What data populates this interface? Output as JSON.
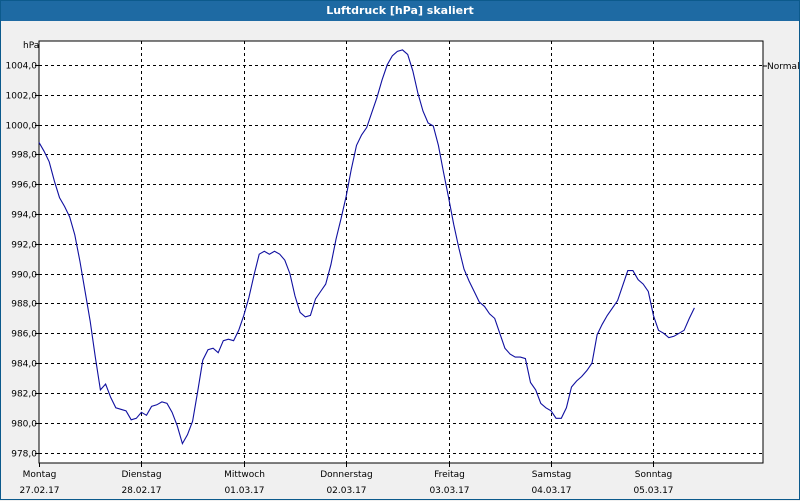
{
  "window": {
    "title": "Luftdruck [hPa] skaliert"
  },
  "chart_data": {
    "type": "line",
    "title": "Luftdruck [hPa] skaliert",
    "ylabel": "hPa",
    "xlabel": "",
    "ylim": [
      977.3,
      1005.6
    ],
    "y_ticks": [
      "978,0",
      "980,0",
      "982,0",
      "984,0",
      "986,0",
      "988,0",
      "990,0",
      "992,0",
      "994,0",
      "996,0",
      "998,0",
      "1000,0",
      "1002,0",
      "1004,0"
    ],
    "y_tick_values": [
      978,
      980,
      982,
      984,
      986,
      988,
      990,
      992,
      994,
      996,
      998,
      1000,
      1002,
      1004
    ],
    "x_range_days": [
      0,
      7.07
    ],
    "x_ticks": [
      {
        "day": "Montag",
        "date": "27.02.17"
      },
      {
        "day": "Dienstag",
        "date": "28.02.17"
      },
      {
        "day": "Mittwoch",
        "date": "01.03.17"
      },
      {
        "day": "Donnerstag",
        "date": "02.03.17"
      },
      {
        "day": "Freitag",
        "date": "03.03.17"
      },
      {
        "day": "Samstag",
        "date": "04.03.17"
      },
      {
        "day": "Sonntag",
        "date": "05.03.17"
      }
    ],
    "grid": true,
    "legend": "right",
    "right_label": "Normal",
    "line_color": "#1010a0",
    "series": [
      {
        "values": [
          [
            0.0,
            998.8
          ],
          [
            0.05,
            998.2
          ],
          [
            0.1,
            997.5
          ],
          [
            0.15,
            996.2
          ],
          [
            0.2,
            995.1
          ],
          [
            0.25,
            994.5
          ],
          [
            0.3,
            993.8
          ],
          [
            0.35,
            992.6
          ],
          [
            0.4,
            990.8
          ],
          [
            0.45,
            988.8
          ],
          [
            0.5,
            986.8
          ],
          [
            0.55,
            984.4
          ],
          [
            0.6,
            982.2
          ],
          [
            0.65,
            982.6
          ],
          [
            0.7,
            981.7
          ],
          [
            0.75,
            981.0
          ],
          [
            0.8,
            980.9
          ],
          [
            0.85,
            980.8
          ],
          [
            0.9,
            980.2
          ],
          [
            0.95,
            980.3
          ],
          [
            1.0,
            980.7
          ],
          [
            1.05,
            980.5
          ],
          [
            1.1,
            981.1
          ],
          [
            1.15,
            981.2
          ],
          [
            1.2,
            981.4
          ],
          [
            1.25,
            981.3
          ],
          [
            1.3,
            980.7
          ],
          [
            1.35,
            979.8
          ],
          [
            1.4,
            978.6
          ],
          [
            1.45,
            979.2
          ],
          [
            1.5,
            980.1
          ],
          [
            1.55,
            982.1
          ],
          [
            1.6,
            984.2
          ],
          [
            1.65,
            984.9
          ],
          [
            1.7,
            985.0
          ],
          [
            1.75,
            984.7
          ],
          [
            1.8,
            985.5
          ],
          [
            1.85,
            985.6
          ],
          [
            1.9,
            985.5
          ],
          [
            1.95,
            986.2
          ],
          [
            2.0,
            987.2
          ],
          [
            2.05,
            988.4
          ],
          [
            2.1,
            989.9
          ],
          [
            2.15,
            991.3
          ],
          [
            2.2,
            991.5
          ],
          [
            2.25,
            991.3
          ],
          [
            2.3,
            991.5
          ],
          [
            2.35,
            991.3
          ],
          [
            2.4,
            990.9
          ],
          [
            2.45,
            990.0
          ],
          [
            2.5,
            988.5
          ],
          [
            2.55,
            987.4
          ],
          [
            2.6,
            987.1
          ],
          [
            2.65,
            987.2
          ],
          [
            2.7,
            988.3
          ],
          [
            2.75,
            988.8
          ],
          [
            2.8,
            989.3
          ],
          [
            2.85,
            990.6
          ],
          [
            2.9,
            992.3
          ],
          [
            2.95,
            993.7
          ],
          [
            3.0,
            995.2
          ],
          [
            3.05,
            997.0
          ],
          [
            3.1,
            998.6
          ],
          [
            3.15,
            999.3
          ],
          [
            3.2,
            999.8
          ],
          [
            3.25,
            1000.8
          ],
          [
            3.3,
            1001.8
          ],
          [
            3.35,
            1003.0
          ],
          [
            3.4,
            1004.0
          ],
          [
            3.45,
            1004.6
          ],
          [
            3.5,
            1004.9
          ],
          [
            3.55,
            1005.0
          ],
          [
            3.6,
            1004.7
          ],
          [
            3.65,
            1003.6
          ],
          [
            3.7,
            1002.1
          ],
          [
            3.75,
            1000.9
          ],
          [
            3.8,
            1000.1
          ],
          [
            3.85,
            999.9
          ],
          [
            3.9,
            998.6
          ],
          [
            3.95,
            996.8
          ],
          [
            4.0,
            995.1
          ],
          [
            4.05,
            993.3
          ],
          [
            4.1,
            991.7
          ],
          [
            4.15,
            990.3
          ],
          [
            4.2,
            989.5
          ],
          [
            4.25,
            988.8
          ],
          [
            4.3,
            988.1
          ],
          [
            4.35,
            987.8
          ],
          [
            4.4,
            987.3
          ],
          [
            4.45,
            987.0
          ],
          [
            4.5,
            986.0
          ],
          [
            4.55,
            985.0
          ],
          [
            4.6,
            984.6
          ],
          [
            4.65,
            984.4
          ],
          [
            4.7,
            984.4
          ],
          [
            4.75,
            984.3
          ],
          [
            4.8,
            982.7
          ],
          [
            4.85,
            982.2
          ],
          [
            4.9,
            981.3
          ],
          [
            4.95,
            981.0
          ],
          [
            5.0,
            980.8
          ],
          [
            5.05,
            980.3
          ],
          [
            5.1,
            980.3
          ],
          [
            5.15,
            981.0
          ],
          [
            5.2,
            982.4
          ],
          [
            5.25,
            982.8
          ],
          [
            5.3,
            983.1
          ],
          [
            5.35,
            983.5
          ],
          [
            5.4,
            984.0
          ],
          [
            5.45,
            985.9
          ],
          [
            5.5,
            986.6
          ],
          [
            5.55,
            987.2
          ],
          [
            5.6,
            987.7
          ],
          [
            5.65,
            988.2
          ],
          [
            5.7,
            989.2
          ],
          [
            5.75,
            990.2
          ],
          [
            5.8,
            990.2
          ],
          [
            5.85,
            989.6
          ],
          [
            5.9,
            989.3
          ],
          [
            5.95,
            988.8
          ],
          [
            6.0,
            987.2
          ],
          [
            6.05,
            986.2
          ],
          [
            6.1,
            986.0
          ],
          [
            6.15,
            985.7
          ],
          [
            6.2,
            985.8
          ],
          [
            6.25,
            986.0
          ],
          [
            6.3,
            986.2
          ],
          [
            6.35,
            987.0
          ],
          [
            6.4,
            987.7
          ]
        ]
      }
    ]
  }
}
